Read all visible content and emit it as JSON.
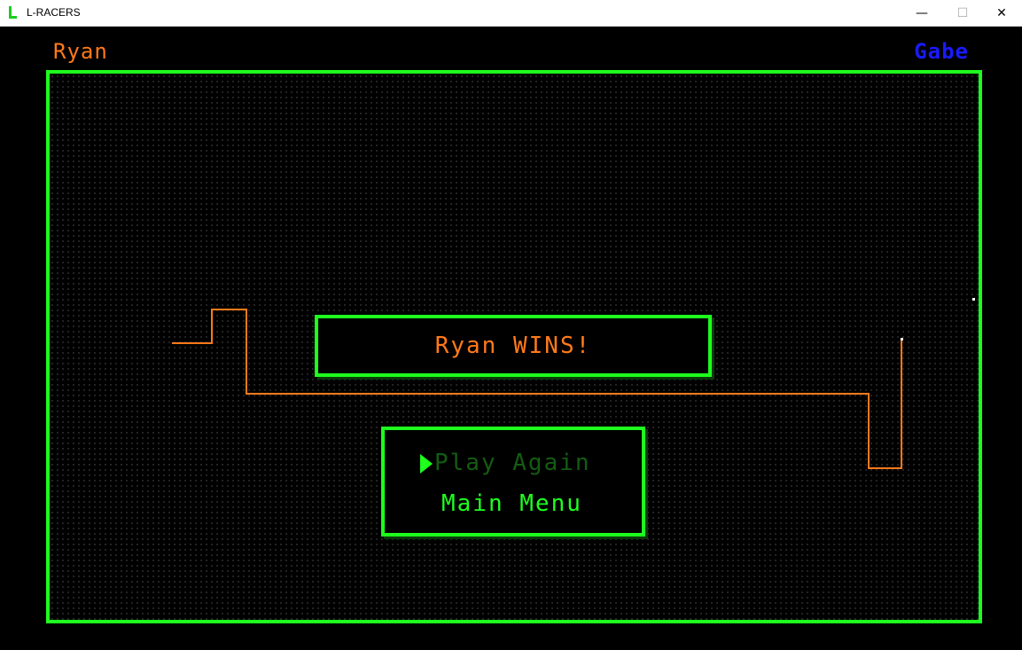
{
  "window": {
    "title": "L-RACERS",
    "minimize_glyph": "—",
    "maximize_glyph": "☐",
    "close_glyph": "✕",
    "icon": "l-letter-icon"
  },
  "players": {
    "left": {
      "name": "Ryan",
      "color": "#ff7a1a"
    },
    "right": {
      "name": "Gabe",
      "color": "#1a1aff"
    }
  },
  "result": {
    "message": "Ryan WINS!"
  },
  "menu": {
    "selected_index": 0,
    "items": [
      "Play Again",
      "Main Menu"
    ]
  },
  "colors": {
    "arena_border": "#1eff1e",
    "menu_dim": "#135c13",
    "trail": "#ff7a1a"
  }
}
